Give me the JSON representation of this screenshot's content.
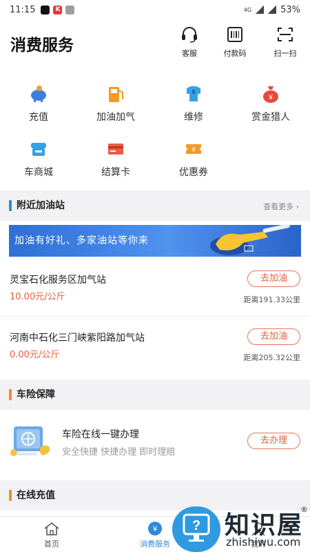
{
  "status_bar": {
    "time": "11:15",
    "battery": "53%",
    "network": "4G"
  },
  "header": {
    "title": "消费服务",
    "actions": [
      {
        "label": "客服"
      },
      {
        "label": "付款码"
      },
      {
        "label": "扫一扫"
      }
    ]
  },
  "quick_actions": [
    {
      "label": "充值",
      "icon": "piggy-bank-icon"
    },
    {
      "label": "加油加气",
      "icon": "fuel-pump-icon"
    },
    {
      "label": "维修",
      "icon": "repair-shirt-icon"
    },
    {
      "label": "赏金猎人",
      "icon": "money-bag-icon"
    },
    {
      "label": "车商城",
      "icon": "store-icon"
    },
    {
      "label": "结算卡",
      "icon": "card-icon"
    },
    {
      "label": "优惠券",
      "icon": "coupon-icon"
    }
  ],
  "nearby": {
    "title": "附近加油站",
    "more": "查看更多 ›",
    "banner_text": "加油有好礼、多家油站等你来",
    "stations": [
      {
        "name": "灵宝石化服务区加气站",
        "price": "10.00元/公斤",
        "distance": "距离191.33公里",
        "button": "去加油"
      },
      {
        "name": "河南中石化三门峡紫阳路加气站",
        "price": "0.00元/公斤",
        "distance": "距离205.32公里",
        "button": "去加油"
      }
    ]
  },
  "insurance": {
    "title": "车险保障",
    "item_title": "车险在线一键办理",
    "item_sub": "安全快捷 快捷办理 即时理赔",
    "button": "去办理"
  },
  "recharge": {
    "title": "在线充值"
  },
  "tabbar": {
    "tabs": [
      {
        "label": "首页"
      },
      {
        "label": "消费服务"
      },
      {
        "label": "我的"
      }
    ]
  },
  "watermark": {
    "title": "知识屋",
    "sub": "zhishiwu.com",
    "mark": "®"
  },
  "colors": {
    "accent_orange": "#e0603f",
    "brand_blue": "#2f8bd8",
    "section_bar": "#f08a2a"
  }
}
